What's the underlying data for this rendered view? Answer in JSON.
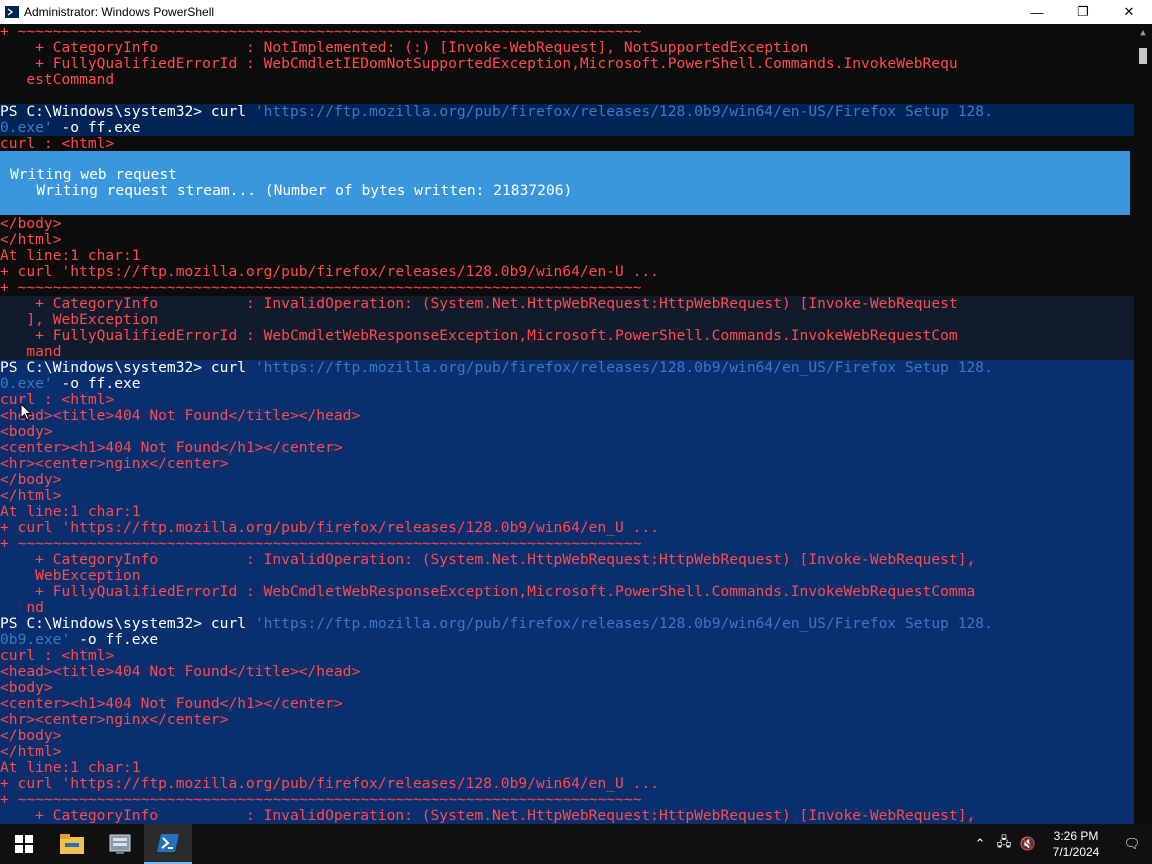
{
  "window": {
    "title": "Administrator: Windows PowerShell",
    "controls": {
      "minimize": "—",
      "restore": "❐",
      "close": "✕"
    }
  },
  "console_lines": [
    {
      "text": "+ ~~~~~~~~~~~~~~~~~~~~~~~~~~~~~~~~~~~~~~~~~~~~~~~~~~~~~~~~~~~~~~~~~~~~~~~",
      "color": "r",
      "bg": "d"
    },
    {
      "text": "    + CategoryInfo          : NotImplemented: (:) [Invoke-WebRequest], NotSupportedException",
      "color": "r",
      "bg": "d"
    },
    {
      "text": "    + FullyQualifiedErrorId : WebCmdletIEDomNotSupportedException,Microsoft.PowerShell.Commands.InvokeWebRequ",
      "color": "r",
      "bg": "d"
    },
    {
      "text": "   estCommand",
      "color": "r",
      "bg": "d"
    },
    {
      "text": "",
      "color": "y",
      "bg": "d"
    },
    {
      "text": "PS C:\\Windows\\system32> curl ",
      "tail": "'https://ftp.mozilla.org/pub/firefox/releases/128.0b9/win64/en-US/Firefox Setup 128.",
      "color": "y",
      "bg": "b"
    },
    {
      "text": "0.exe'",
      "tail": " -o ff.exe",
      "color": "s",
      "tailColor": "y",
      "bg": "b"
    },
    {
      "text": "curl : <html>",
      "color": "r",
      "bg": "d"
    },
    {
      "text": "",
      "color": "r",
      "bg": "d"
    },
    {
      "text": "",
      "color": "r",
      "bg": "d"
    },
    {
      "text": "",
      "color": "r",
      "bg": "d"
    },
    {
      "text": "",
      "color": "r",
      "bg": "d"
    },
    {
      "text": "</body>",
      "color": "r",
      "bg": "d"
    },
    {
      "text": "</html>",
      "color": "r",
      "bg": "d"
    },
    {
      "text": "At line:1 char:1",
      "color": "r",
      "bg": "d"
    },
    {
      "text": "+ curl 'https://ftp.mozilla.org/pub/firefox/releases/128.0b9/win64/en-U ...",
      "color": "r",
      "bg": "d"
    },
    {
      "text": "+ ~~~~~~~~~~~~~~~~~~~~~~~~~~~~~~~~~~~~~~~~~~~~~~~~~~~~~~~~~~~~~~~~~~~~~~~",
      "color": "r",
      "bg": "d"
    },
    {
      "text": "    + CategoryInfo          : InvalidOperation: (System.Net.HttpWebRequest:HttpWebRequest) [Invoke-WebRequest",
      "color": "r",
      "bg": "dk"
    },
    {
      "text": "   ], WebException",
      "color": "r",
      "bg": "dk"
    },
    {
      "text": "    + FullyQualifiedErrorId : WebCmdletWebResponseException,Microsoft.PowerShell.Commands.InvokeWebRequestCom",
      "color": "r",
      "bg": "dk"
    },
    {
      "text": "   mand",
      "color": "r",
      "bg": "dk"
    },
    {
      "text": "PS C:\\Windows\\system32> curl ",
      "tail": "'https://ftp.mozilla.org/pub/firefox/releases/128.0b9/win64/en_US/Firefox Setup 128.",
      "color": "y",
      "bg": "hl"
    },
    {
      "text": "0.exe'",
      "tail": " -o ff.exe",
      "color": "s",
      "tailColor": "y",
      "bg": "hl"
    },
    {
      "text": "curl : <html>",
      "color": "r",
      "bg": "hl"
    },
    {
      "text": "<head><title>404 Not Found</title></head>",
      "color": "r",
      "bg": "hl"
    },
    {
      "text": "<body>",
      "color": "r",
      "bg": "hl"
    },
    {
      "text": "<center><h1>404 Not Found</h1></center>",
      "color": "r",
      "bg": "hl"
    },
    {
      "text": "<hr><center>nginx</center>",
      "color": "r",
      "bg": "hl"
    },
    {
      "text": "</body>",
      "color": "r",
      "bg": "hl"
    },
    {
      "text": "</html>",
      "color": "r",
      "bg": "hl"
    },
    {
      "text": "At line:1 char:1",
      "color": "r",
      "bg": "hl"
    },
    {
      "text": "+ curl 'https://ftp.mozilla.org/pub/firefox/releases/128.0b9/win64/en_U ...",
      "color": "r",
      "bg": "hl"
    },
    {
      "text": "+ ~~~~~~~~~~~~~~~~~~~~~~~~~~~~~~~~~~~~~~~~~~~~~~~~~~~~~~~~~~~~~~~~~~~~~~~",
      "color": "r",
      "bg": "hl"
    },
    {
      "text": "    + CategoryInfo          : InvalidOperation: (System.Net.HttpWebRequest:HttpWebRequest) [Invoke-WebRequest],",
      "color": "r",
      "bg": "hl"
    },
    {
      "text": "    WebException",
      "color": "r",
      "bg": "hl"
    },
    {
      "text": "    + FullyQualifiedErrorId : WebCmdletWebResponseException,Microsoft.PowerShell.Commands.InvokeWebRequestComma",
      "color": "r",
      "bg": "hl"
    },
    {
      "text": "   nd",
      "color": "r",
      "bg": "hl"
    },
    {
      "text": "PS C:\\Windows\\system32> curl ",
      "tail": "'https://ftp.mozilla.org/pub/firefox/releases/128.0b9/win64/en_US/Firefox Setup 128.",
      "color": "y",
      "bg": "hl"
    },
    {
      "text": "0b9.exe'",
      "tail": " -o ff.exe",
      "color": "s",
      "tailColor": "y",
      "bg": "hl"
    },
    {
      "text": "curl : <html>",
      "color": "r",
      "bg": "hl"
    },
    {
      "text": "<head><title>404 Not Found</title></head>",
      "color": "r",
      "bg": "hl"
    },
    {
      "text": "<body>",
      "color": "r",
      "bg": "hl"
    },
    {
      "text": "<center><h1>404 Not Found</h1></center>",
      "color": "r",
      "bg": "hl"
    },
    {
      "text": "<hr><center>nginx</center>",
      "color": "r",
      "bg": "hl"
    },
    {
      "text": "</body>",
      "color": "r",
      "bg": "hl"
    },
    {
      "text": "</html>",
      "color": "r",
      "bg": "hl"
    },
    {
      "text": "At line:1 char:1",
      "color": "r",
      "bg": "hl"
    },
    {
      "text": "+ curl 'https://ftp.mozilla.org/pub/firefox/releases/128.0b9/win64/en_U ...",
      "color": "r",
      "bg": "hl"
    },
    {
      "text": "+ ~~~~~~~~~~~~~~~~~~~~~~~~~~~~~~~~~~~~~~~~~~~~~~~~~~~~~~~~~~~~~~~~~~~~~~~",
      "color": "r",
      "bg": "hl"
    },
    {
      "text": "    + CategoryInfo          : InvalidOperation: (System.Net.HttpWebRequest:HttpWebRequest) [Invoke-WebRequest],",
      "color": "r",
      "bg": "hl"
    }
  ],
  "progress": {
    "activity": "Writing web request",
    "status": "   Writing request stream... (Number of bytes written: 21837206)"
  },
  "taskbar": {
    "start_icon": "windows-logo-icon",
    "pinned": [
      "file-explorer-icon",
      "server-manager-icon",
      "powershell-icon"
    ],
    "active": "powershell-icon"
  },
  "tray": {
    "time": "3:26 PM",
    "date": "7/1/2024",
    "icons": [
      "chevron-up-icon",
      "network-icon",
      "volume-muted-icon",
      "notifications-icon"
    ]
  }
}
